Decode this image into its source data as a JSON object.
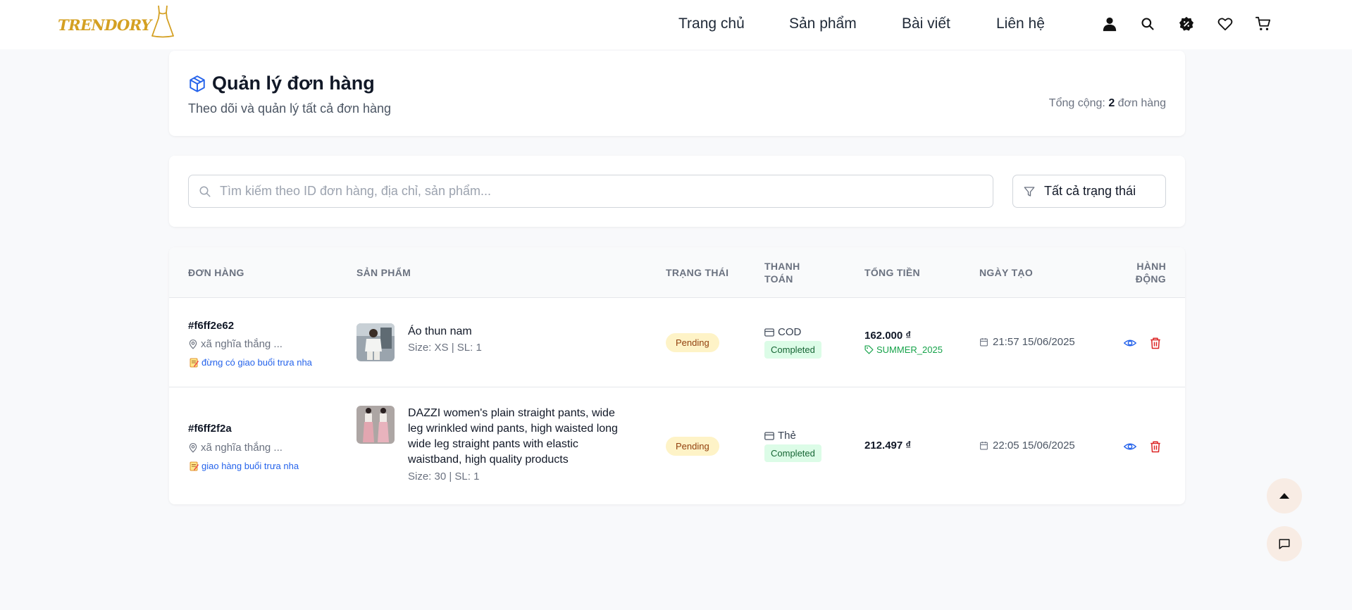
{
  "header": {
    "logo_text": "TRENDORY",
    "nav": [
      "Trang chủ",
      "Sản phẩm",
      "Bài viết",
      "Liên hệ"
    ]
  },
  "page": {
    "title": "Quản lý đơn hàng",
    "subtitle": "Theo dõi và quản lý tất cả đơn hàng",
    "total_prefix": "Tổng cộng:",
    "total_count": "2",
    "total_suffix": "đơn hàng"
  },
  "filters": {
    "search_placeholder": "Tìm kiếm theo ID đơn hàng, địa chỉ, sản phẩm...",
    "status_filter": "Tất cả trạng thái"
  },
  "table": {
    "columns": {
      "order": "ĐƠN HÀNG",
      "product": "SẢN PHẨM",
      "status": "TRẠNG THÁI",
      "payment_line1": "THANH",
      "payment_line2": "TOÁN",
      "total": "TỔNG TIỀN",
      "created": "NGÀY TẠO",
      "actions_line1": "HÀNH",
      "actions_line2": "ĐỘNG"
    },
    "rows": [
      {
        "id": "#f6ff2e62",
        "address": "xã nghĩa thắng ...",
        "note": "đừng có giao buổi trưa nha",
        "product_name": "Áo thun nam",
        "product_meta": "Size: XS | SL: 1",
        "status": "Pending",
        "payment_method": "COD",
        "payment_status": "Completed",
        "amount": "162.000 ₫",
        "coupon": "SUMMER_2025",
        "date": "21:57 15/06/2025"
      },
      {
        "id": "#f6ff2f2a",
        "address": "xã nghĩa thắng ...",
        "note": "giao hàng buổi trưa nha",
        "product_name_lines": [
          "DAZZI women's plain straight pants, wide",
          "leg wrinkled wind pants, high waisted long",
          "wide leg straight pants with elastic",
          "waistband, high quality products"
        ],
        "product_meta": "Size: 30 | SL: 1",
        "status": "Pending",
        "payment_method": "Thẻ",
        "payment_status": "Completed",
        "amount": "212.497 ₫",
        "date": "22:05 15/06/2025"
      }
    ]
  },
  "colors": {
    "brand": "#d4a022",
    "accent_blue": "#2563eb",
    "danger": "#dc2626",
    "pending_bg": "#fef3c7",
    "completed_bg": "#dcfce7"
  }
}
